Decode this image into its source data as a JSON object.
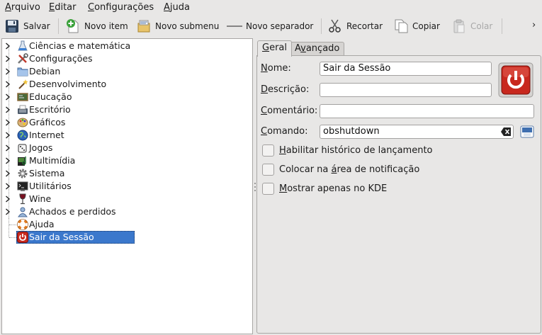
{
  "menubar": {
    "items": [
      {
        "label": "Arquivo",
        "mnemonic": "A",
        "rest": "rquivo"
      },
      {
        "label": "Editar",
        "mnemonic": "E",
        "rest": "ditar"
      },
      {
        "label": "Configurações",
        "mnemonic": "C",
        "rest": "onfigurações"
      },
      {
        "label": "Ajuda",
        "mnemonic": "A",
        "rest": "juda"
      }
    ]
  },
  "toolbar": {
    "save_label": "Salvar",
    "new_item_label": "Novo item",
    "new_submenu_label": "Novo submenu",
    "new_separator_label": "Novo separador",
    "cut_label": "Recortar",
    "copy_label": "Copiar",
    "paste_label": "Colar",
    "more_glyph": "›"
  },
  "tree": {
    "items": [
      {
        "label": "Ciências e matemática",
        "icon": "flask-icon"
      },
      {
        "label": "Configurações",
        "icon": "tools-icon"
      },
      {
        "label": "Debian",
        "icon": "folder-icon"
      },
      {
        "label": "Desenvolvimento",
        "icon": "wand-icon"
      },
      {
        "label": "Educação",
        "icon": "chalkboard-icon"
      },
      {
        "label": "Escritório",
        "icon": "typewriter-icon"
      },
      {
        "label": "Gráficos",
        "icon": "palette-icon"
      },
      {
        "label": "Internet",
        "icon": "globe-icon"
      },
      {
        "label": "Jogos",
        "icon": "dice-icon"
      },
      {
        "label": "Multimídia",
        "icon": "media-icon"
      },
      {
        "label": "Sistema",
        "icon": "gear-icon"
      },
      {
        "label": "Utilitários",
        "icon": "terminal-icon"
      },
      {
        "label": "Wine",
        "icon": "wine-glass-icon"
      },
      {
        "label": "Achados e perdidos",
        "icon": "lost-found-icon"
      },
      {
        "label": "Ajuda",
        "icon": "lifebuoy-icon"
      },
      {
        "label": "Sair da Sessão",
        "icon": "power-icon",
        "selected": true
      }
    ]
  },
  "tabs": [
    {
      "label": "Geral",
      "mnemonic": "G",
      "rest": "eral",
      "active": true
    },
    {
      "label": "Avançado",
      "pre": "A",
      "mnemonic": "v",
      "rest": "ançado",
      "active": false
    }
  ],
  "form": {
    "name": {
      "label": "Nome:",
      "mnemonic": "N",
      "rest": "ome:",
      "value": "Sair da Sessão"
    },
    "description": {
      "label": "Descrição:",
      "mnemonic": "D",
      "rest": "escrição:",
      "value": ""
    },
    "comment": {
      "label": "Comentário:",
      "mnemonic": "C",
      "rest": "omentário:",
      "value": ""
    },
    "command": {
      "label": "Comando:",
      "mnemonic": "C",
      "rest": "omando:",
      "value": "obshutdown"
    },
    "icon_button": "power-icon",
    "checkboxes": [
      {
        "label": "Habilitar histórico de lançamento",
        "pre": "",
        "mnemonic": "H",
        "rest": "abilitar histórico de lançamento",
        "checked": false
      },
      {
        "label": "Colocar na área de notificação",
        "pre": "Colocar na ",
        "mnemonic": "á",
        "rest": "rea de notificação",
        "checked": false
      },
      {
        "label": "Mostrar apenas no KDE",
        "pre": "",
        "mnemonic": "M",
        "rest": "ostrar apenas no KDE",
        "checked": false
      }
    ]
  },
  "colors": {
    "window_bg": "#e8e7e6",
    "selection": "#3b78cc",
    "power_red": "#c8281e"
  }
}
